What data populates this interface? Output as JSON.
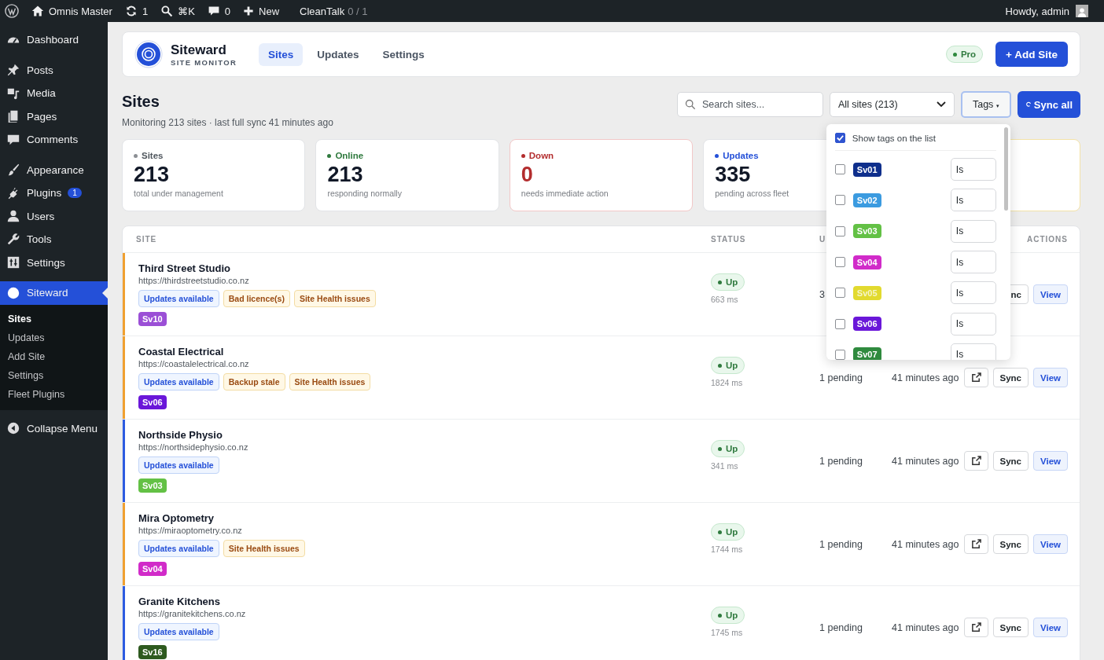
{
  "admin_bar": {
    "site": "Omnis Master",
    "updates": "1",
    "search": "⌘K",
    "comments": "0",
    "new": "New",
    "plugin": "CleanTalk",
    "plugin_count": "0 / 1",
    "greeting": "Howdy, admin"
  },
  "sidebar": {
    "groups": [
      [
        {
          "kind": "dashboard",
          "label": "Dashboard",
          "selected": false
        }
      ],
      [
        {
          "kind": "pin",
          "label": "Posts",
          "selected": false
        },
        {
          "kind": "media",
          "label": "Media",
          "selected": false
        },
        {
          "kind": "pages",
          "label": "Pages",
          "selected": false
        },
        {
          "kind": "comment",
          "label": "Comments",
          "selected": false
        }
      ],
      [
        {
          "kind": "brush",
          "label": "Appearance",
          "selected": false
        },
        {
          "kind": "plug",
          "label": "Plugins",
          "badge": "1",
          "selected": false
        },
        {
          "kind": "user",
          "label": "Users",
          "selected": false
        },
        {
          "kind": "wrench",
          "label": "Tools",
          "selected": false
        },
        {
          "kind": "sliders",
          "label": "Settings",
          "selected": false
        }
      ],
      [
        {
          "kind": "circle",
          "label": "Siteward",
          "selected": true
        }
      ]
    ],
    "submenu": [
      {
        "label": "Sites",
        "selected": true
      },
      {
        "label": "Updates",
        "selected": false
      },
      {
        "label": "Add Site",
        "selected": false
      },
      {
        "label": "Settings",
        "selected": false
      },
      {
        "label": "Fleet Plugins",
        "selected": false
      }
    ],
    "collapse": "Collapse Menu"
  },
  "header": {
    "brand": "Siteward",
    "tagline": "SITE MONITOR",
    "nav": [
      {
        "label": "Sites",
        "selected": true
      },
      {
        "label": "Updates",
        "selected": false
      },
      {
        "label": "Settings",
        "selected": false
      }
    ],
    "plan": "Pro",
    "add_button": "+ Add Site"
  },
  "page": {
    "title": "Sites",
    "subtitle": "Monitoring 213 sites · last full sync 41 minutes ago",
    "search": {
      "placeholder": "Search sites..."
    },
    "filter": "All sites (213)",
    "tags_button": {
      "label": "Tags",
      "caret": "▾",
      "expanded": true
    },
    "sync_all": "Sync all"
  },
  "tag_menu": {
    "show_tags": {
      "label": "Show tags on the list",
      "checked": true
    },
    "tags": [
      {
        "name": "Sv01",
        "color": "#0f2f8c",
        "checked": false,
        "operator": "Is"
      },
      {
        "name": "Sv02",
        "color": "#3b9be0",
        "checked": false,
        "operator": "Is"
      },
      {
        "name": "Sv03",
        "color": "#63c145",
        "checked": false,
        "operator": "Is"
      },
      {
        "name": "Sv04",
        "color": "#d12bc9",
        "checked": false,
        "operator": "Is"
      },
      {
        "name": "Sv05",
        "color": "#e2da2f",
        "checked": false,
        "operator": "Is"
      },
      {
        "name": "Sv06",
        "color": "#6a17d9",
        "checked": false,
        "operator": "Is"
      },
      {
        "name": "Sv07",
        "color": "#2f8a3e",
        "checked": false,
        "operator": "Is"
      }
    ]
  },
  "stats": [
    {
      "kind": "neutral",
      "label": "Sites",
      "value": "213",
      "note": "total under management"
    },
    {
      "kind": "good",
      "label": "Online",
      "value": "213",
      "note": "responding normally"
    },
    {
      "kind": "bad",
      "label": "Down",
      "value": "0",
      "note": "needs immediate action"
    },
    {
      "kind": "info",
      "label": "Updates",
      "value": "335",
      "note": "pending across fleet"
    },
    {
      "kind": "warn"
    }
  ],
  "table": {
    "columns": [
      {
        "label": "SITE"
      },
      {
        "label": "STATUS"
      },
      {
        "label": "U"
      },
      {
        "label": "ACTIONS"
      }
    ],
    "rows": [
      {
        "name": "Third Street Studio",
        "url": "https://thirdstreetstudio.co.nz",
        "color": "#f0a030",
        "issues": [
          {
            "kind": "update",
            "label": "Updates available"
          },
          {
            "kind": "warning",
            "label": "Bad licence(s)"
          },
          {
            "kind": "warning",
            "label": "Site Health issues"
          }
        ],
        "tags": [
          {
            "name": "Sv10",
            "color": "#9b4fd6"
          }
        ],
        "status": {
          "kind": "up",
          "label": "Up"
        },
        "latency": "663 ms",
        "updates": "3",
        "actions": [
          {
            "kind": "sync",
            "label": "nc"
          },
          {
            "kind": "view",
            "label": "View"
          }
        ]
      },
      {
        "name": "Coastal Electrical",
        "url": "https://coastalelectrical.co.nz",
        "color": "#f0a030",
        "issues": [
          {
            "kind": "update",
            "label": "Updates available"
          },
          {
            "kind": "warning",
            "label": "Backup stale"
          },
          {
            "kind": "warning",
            "label": "Site Health issues"
          }
        ],
        "tags": [
          {
            "name": "Sv06",
            "color": "#6a17d9"
          }
        ],
        "status": {
          "kind": "up",
          "label": "Up"
        },
        "latency": "1824 ms",
        "updates": "1 pending",
        "last_sync": "41 minutes ago",
        "actions": [
          {
            "kind": "open"
          },
          {
            "kind": "sync",
            "label": "Sync"
          },
          {
            "kind": "view",
            "label": "View"
          }
        ]
      },
      {
        "name": "Northside Physio",
        "url": "https://northsidephysio.co.nz",
        "color": "#2c5be0",
        "issues": [
          {
            "kind": "update",
            "label": "Updates available"
          }
        ],
        "tags": [
          {
            "name": "Sv03",
            "color": "#63c145"
          }
        ],
        "status": {
          "kind": "up",
          "label": "Up"
        },
        "latency": "341 ms",
        "updates": "1 pending",
        "last_sync": "41 minutes ago",
        "actions": [
          {
            "kind": "open"
          },
          {
            "kind": "sync",
            "label": "Sync"
          },
          {
            "kind": "view",
            "label": "View"
          }
        ]
      },
      {
        "name": "Mira Optometry",
        "url": "https://miraoptometry.co.nz",
        "color": "#f0a030",
        "issues": [
          {
            "kind": "update",
            "label": "Updates available"
          },
          {
            "kind": "warning",
            "label": "Site Health issues"
          }
        ],
        "tags": [
          {
            "name": "Sv04",
            "color": "#d12bc9"
          }
        ],
        "status": {
          "kind": "up",
          "label": "Up"
        },
        "latency": "1744 ms",
        "updates": "1 pending",
        "last_sync": "41 minutes ago",
        "actions": [
          {
            "kind": "open"
          },
          {
            "kind": "sync",
            "label": "Sync"
          },
          {
            "kind": "view",
            "label": "View"
          }
        ]
      },
      {
        "name": "Granite Kitchens",
        "url": "https://granitekitchens.co.nz",
        "color": "#2c5be0",
        "issues": [
          {
            "kind": "update",
            "label": "Updates available"
          }
        ],
        "tags": [
          {
            "name": "Sv16",
            "color": "#2e5a1f"
          }
        ],
        "status": {
          "kind": "up",
          "label": "Up"
        },
        "latency": "1745 ms",
        "updates": "1 pending",
        "last_sync": "41 minutes ago",
        "actions": [
          {
            "kind": "open"
          },
          {
            "kind": "sync",
            "label": "Sync"
          },
          {
            "kind": "view",
            "label": "View"
          }
        ]
      }
    ]
  }
}
